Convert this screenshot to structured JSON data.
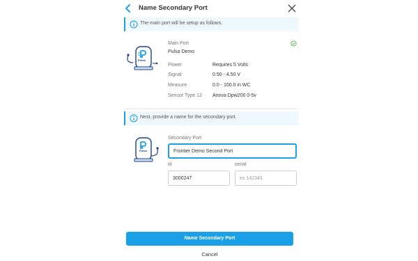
{
  "header": {
    "title": "Name Secondary Port",
    "back_icon": "chevron-left-icon",
    "close_icon": "close-icon"
  },
  "main_info": {
    "icon": "info-icon",
    "text": "The main port will be setup as follows."
  },
  "main_port": {
    "label": "Main Port",
    "name": "Pulsa Demo",
    "status_icon": "check-circle-icon",
    "details": [
      {
        "label": "Power",
        "value": "Requires 5 Volts"
      },
      {
        "label": "Signal",
        "value": "0.50 - 4.50 V"
      },
      {
        "label": "Measure",
        "value": "0.0 - 100.0 in WC"
      },
      {
        "label": "Sensor Type 12",
        "value": "Anova Dpw200 0-5v"
      }
    ]
  },
  "secondary_info": {
    "icon": "info-icon",
    "text": "Next, provide a name for the secondary port."
  },
  "secondary_port": {
    "label": "Secondary Port",
    "name_value": "Frontier Demo Second Port",
    "id_label": "id",
    "id_value": "3000247",
    "serial_label": "serial",
    "serial_placeholder": "ex 142343"
  },
  "device_brand": "Pulsa",
  "actions": {
    "primary": "Name Secondary Port",
    "cancel": "Cancel"
  },
  "colors": {
    "accent": "#1aa0e6",
    "device_outline": "#1d3f8a",
    "success": "#4caf50"
  }
}
